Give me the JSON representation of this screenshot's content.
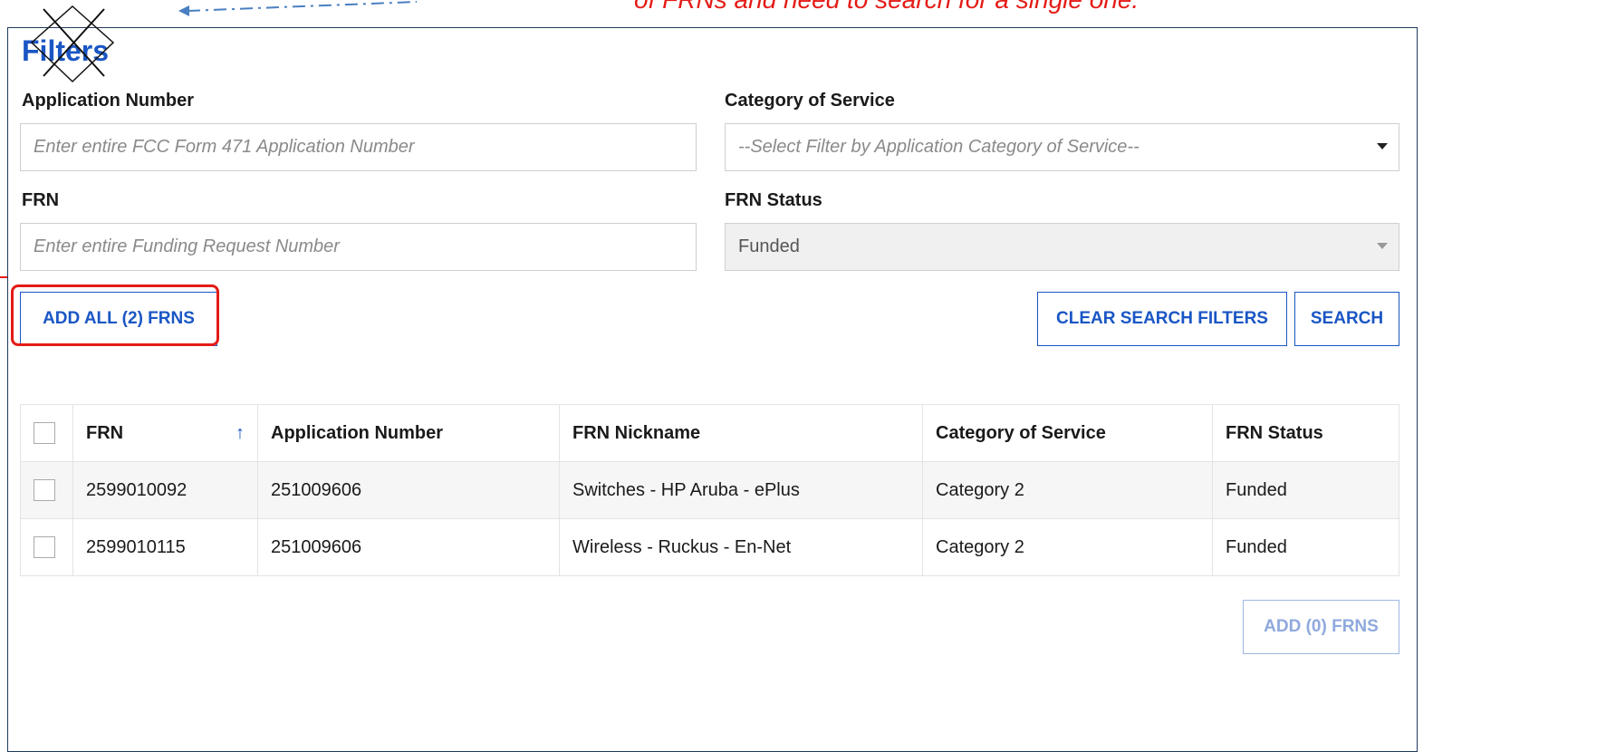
{
  "annotation": {
    "text": "of FRNs and need to search for a single one."
  },
  "filters": {
    "title": "Filters",
    "application_number": {
      "label": "Application Number",
      "placeholder": "Enter entire FCC Form 471 Application Number"
    },
    "category_of_service": {
      "label": "Category of Service",
      "placeholder": "--Select Filter by Application Category of Service--"
    },
    "frn": {
      "label": "FRN",
      "placeholder": "Enter entire Funding Request Number"
    },
    "frn_status": {
      "label": "FRN Status",
      "value": "Funded"
    }
  },
  "buttons": {
    "add_all": "ADD ALL (2) FRNS",
    "clear": "CLEAR SEARCH FILTERS",
    "search": "SEARCH",
    "add_selected": "ADD (0) FRNS"
  },
  "table": {
    "headers": [
      "FRN",
      "Application Number",
      "FRN Nickname",
      "Category of Service",
      "FRN Status"
    ],
    "rows": [
      [
        "2599010092",
        "251009606",
        "Switches - HP Aruba - ePlus",
        "Category 2",
        "Funded"
      ],
      [
        "2599010115",
        "251009606",
        "Wireless - Ruckus - En-Net",
        "Category 2",
        "Funded"
      ]
    ]
  },
  "colors": {
    "accent": "#1a56c4",
    "annotation": "#e41b17"
  },
  "icons": {
    "sort": "arrow-up-icon",
    "dropdown": "caret-down-icon"
  }
}
